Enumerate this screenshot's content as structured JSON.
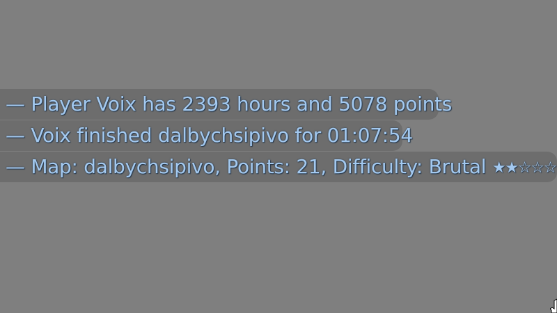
{
  "chat": {
    "lines": [
      {
        "prefix": "—",
        "text": "Player Voix has 2393 hours and 5078 points"
      },
      {
        "prefix": "—",
        "text": "Voix finished dalbychsipivo for 01:07:54"
      },
      {
        "prefix": "—",
        "text": "Map: dalbychsipivo, Points: 21, Difficulty: Brutal",
        "stars": [
          "★",
          "★",
          "☆",
          "☆",
          "☆"
        ],
        "stars_filled": 2,
        "stars_total": 5
      }
    ]
  },
  "colors": {
    "background": "#7f7f7f",
    "text": "#a3c9f0",
    "text_outline": "#27384b",
    "line_background": "#5f5f5f"
  },
  "icons": {
    "cursor": "mouse-cursor-icon"
  }
}
